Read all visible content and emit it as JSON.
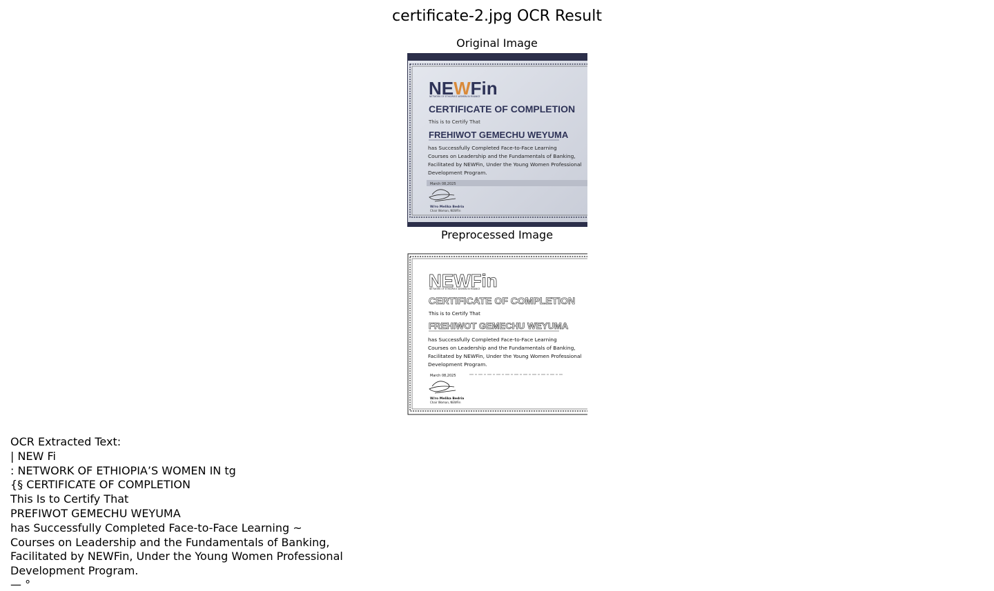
{
  "page": {
    "title": "certificate-2.jpg OCR Result",
    "original_label": "Original Image",
    "preprocessed_label": "Preprocessed Image"
  },
  "certificate": {
    "logo_text_a": "NE",
    "logo_text_w": "W",
    "logo_text_b": "Fin",
    "logo_tagline": "NETWORK OF ETHIOPIA'S WOMEN IN FINANCE",
    "heading": "CERTIFICATE OF COMPLETION",
    "certify_line": "This is to Certify That",
    "recipient": "FREHIWOT GEMECHU WEYUMA",
    "body_lines": [
      "has Successfully Completed Face-to-Face Learning",
      "Courses on Leadership and the Fundamentals of Banking,",
      "Facilitated by NEWFin, Under the Young Women Professional",
      "Development Program."
    ],
    "date": "March 08,2025",
    "signer_name": "W/ro Melika Bedria",
    "signer_title": "Chair Woman, NEWFin"
  },
  "ocr": {
    "label": "OCR Extracted Text:",
    "lines": [
      "| NEW Fi",
      ": NETWORK OF ETHIOPIA’S WOMEN IN tg",
      "{§ CERTIFICATE OF COMPLETION",
      "This Is to Certify That",
      "PREFIWOT GEMECHU WEYUMA",
      "has Successfully Completed Face-to-Face Learning ~",
      "Courses on Leadership and the Fundamentals of Banking,",
      "Facilitated by NEWFin, Under the Young Women Professional",
      "Development Program.",
      "—  °"
    ]
  }
}
